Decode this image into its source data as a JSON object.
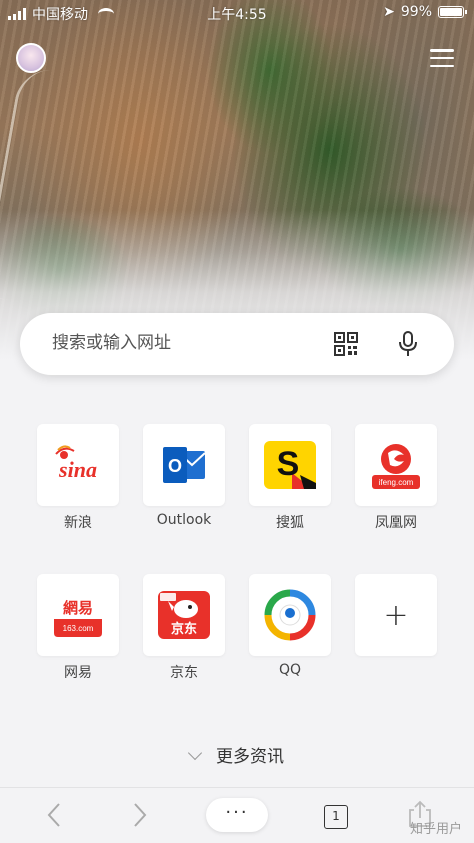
{
  "status_bar": {
    "carrier": "中国移动",
    "time": "上午4:55",
    "battery": "99%",
    "battery_level": 0.99
  },
  "header": {
    "avatar_icon": "user-avatar",
    "menu_icon": "hamburger-menu-icon"
  },
  "search": {
    "placeholder": "搜索或输入网址",
    "qr_icon": "qr-scan-icon",
    "mic_icon": "microphone-icon"
  },
  "shortcuts": [
    {
      "label": "新浪",
      "icon": "sina-logo",
      "logo_text": "sina"
    },
    {
      "label": "Outlook",
      "icon": "outlook-logo",
      "logo_text": "O"
    },
    {
      "label": "搜狐",
      "icon": "sohu-logo",
      "logo_text": "S"
    },
    {
      "label": "凤凰网",
      "icon": "ifeng-logo",
      "logo_text": "ifeng.com"
    },
    {
      "label": "网易",
      "icon": "163-logo",
      "logo_text": "網易",
      "logo_sub": "163.com"
    },
    {
      "label": "京东",
      "icon": "jd-logo",
      "logo_text": "京东"
    },
    {
      "label": "QQ",
      "icon": "qq-logo"
    },
    {
      "label": "",
      "icon": "add-icon",
      "logo_text": "+"
    }
  ],
  "more_news": {
    "label": "更多资讯",
    "icon": "chevron-down-icon"
  },
  "toolbar": {
    "back_icon": "back-arrow-icon",
    "forward_icon": "forward-arrow-icon",
    "menu_label": "···",
    "tab_count": "1",
    "share_icon": "share-icon"
  },
  "watermark": "知乎用户"
}
